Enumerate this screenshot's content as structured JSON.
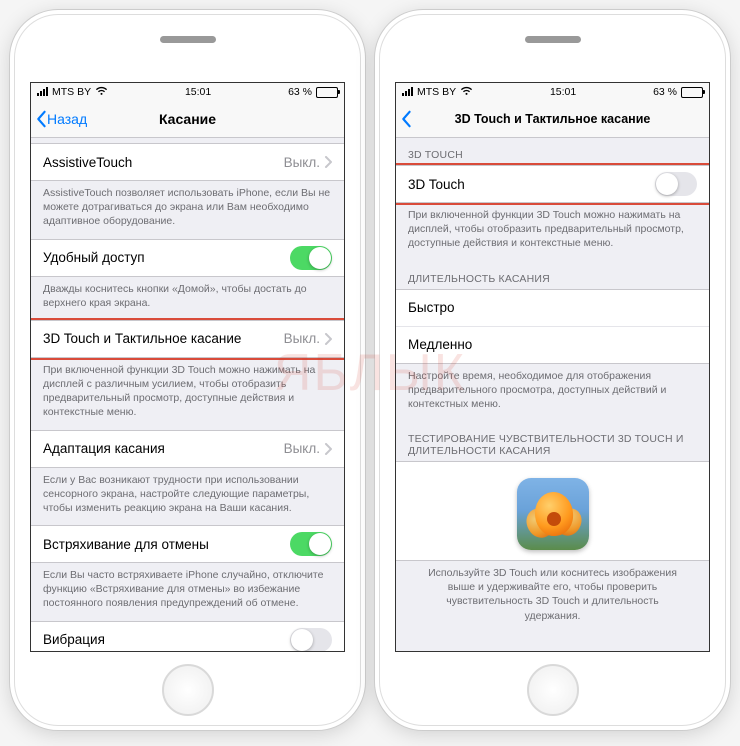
{
  "watermark": "ЯБЛЫК",
  "status": {
    "carrier": "MTS BY",
    "time": "15:01",
    "battery_pct": "63 %"
  },
  "left": {
    "back_label": "Назад",
    "title": "Касание",
    "rows": {
      "assistive": {
        "label": "AssistiveTouch",
        "value": "Выкл."
      },
      "assistive_footer": "AssistiveTouch позволяет использовать iPhone, если Вы не можете дотрагиваться до экрана или Вам необходимо адаптивное оборудование.",
      "reach": {
        "label": "Удобный доступ"
      },
      "reach_footer": "Дважды коснитесь кнопки «Домой», чтобы достать до верхнего края экрана.",
      "touch3d": {
        "label": "3D Touch и Тактильное касание",
        "value": "Выкл."
      },
      "touch3d_footer": "При включенной функции 3D Touch можно нажимать на дисплей с различным усилием, чтобы отобразить предварительный просмотр, доступные действия и контекстные меню.",
      "accom": {
        "label": "Адаптация касания",
        "value": "Выкл."
      },
      "accom_footer": "Если у Вас возникают трудности при использовании сенсорного экрана, настройте следующие параметры, чтобы изменить реакцию экрана на Ваши касания.",
      "shake": {
        "label": "Встряхивание для отмены"
      },
      "shake_footer": "Если Вы часто встряхиваете iPhone случайно, отключите функцию «Встряхивание для отмены» во избежание постоянного появления предупреждений об отмене.",
      "vibration": {
        "label": "Вибрация"
      }
    }
  },
  "right": {
    "title": "3D Touch и Тактильное касание",
    "section_3dtouch": "3D TOUCH",
    "row_3dtouch": {
      "label": "3D Touch"
    },
    "footer_3dtouch": "При включенной функции 3D Touch можно нажимать на дисплей, чтобы отобразить предварительный просмотр, доступные действия и контекстные меню.",
    "section_duration": "ДЛИТЕЛЬНОСТЬ КАСАНИЯ",
    "fast": "Быстро",
    "slow": "Медленно",
    "footer_duration": "Настройте время, необходимое для отображения предварительного просмотра, доступных действий и контекстных меню.",
    "section_test": "ТЕСТИРОВАНИЕ ЧУВСТВИТЕЛЬНОСТИ 3D TOUCH И ДЛИТЕЛЬНОСТИ КАСАНИЯ",
    "footer_test": "Используйте 3D Touch или коснитесь изображения выше и удерживайте его, чтобы проверить чувствительность 3D Touch и длительность удержания."
  }
}
